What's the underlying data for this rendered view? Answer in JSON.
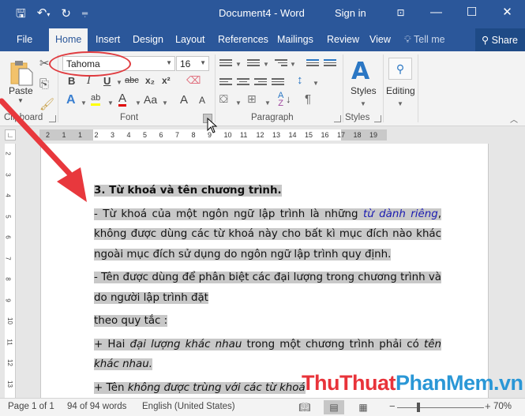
{
  "window": {
    "title": "Document4  -  Word",
    "sign_in": "Sign in",
    "qat_icons": [
      "save-icon",
      "undo-icon",
      "redo-icon",
      "customize-qat-icon"
    ],
    "window_controls": [
      "ribbon-display-options-icon",
      "minimize-icon",
      "maximize-icon",
      "close-icon"
    ]
  },
  "tabs": [
    {
      "label": "File"
    },
    {
      "label": "Home",
      "active": true
    },
    {
      "label": "Insert"
    },
    {
      "label": "Design"
    },
    {
      "label": "Layout"
    },
    {
      "label": "References"
    },
    {
      "label": "Mailings"
    },
    {
      "label": "Review"
    },
    {
      "label": "View"
    },
    {
      "label": "Tell me"
    }
  ],
  "share_label": "Share",
  "ribbon": {
    "clipboard": {
      "label": "Clipboard",
      "paste_label": "Paste"
    },
    "font": {
      "label": "Font",
      "font_name": "Tahoma",
      "font_size": "16",
      "bold": "B",
      "italic": "I",
      "underline": "U",
      "strikethrough": "abc",
      "subscript": "x₂",
      "superscript": "x²",
      "change_case": "Aa",
      "grow": "A",
      "shrink": "A",
      "highlight_color": "#ffff00",
      "font_color": "#e00000"
    },
    "paragraph": {
      "label": "Paragraph"
    },
    "styles": {
      "label": "Styles",
      "button_label": "Styles"
    },
    "editing": {
      "button_label": "Editing"
    }
  },
  "ruler": {
    "labels": [
      "2",
      "1",
      "1",
      "2",
      "3",
      "4",
      "5",
      "6",
      "7",
      "8",
      "9",
      "10",
      "11",
      "12",
      "13",
      "14",
      "15",
      "16",
      "17",
      "18",
      "19"
    ],
    "vertical_labels": [
      "2",
      "3",
      "4",
      "5",
      "6",
      "7",
      "8",
      "9",
      "10",
      "11",
      "12",
      "13"
    ]
  },
  "document": {
    "heading": "3. Từ khoá và tên chương trình.",
    "p1_before": "- Từ khoá của một ngôn ngữ lập trình là những ",
    "p1_keyword": "từ dành riêng",
    "p1_after": ", không được dùng các từ khoá này cho bất kì mục đích nào khác ngoài mục đích sử dụng do ngôn ngữ lập trình quy định.",
    "p2": "- Tên được dùng để phân biệt các đại lượng trong chương trình và do người lập trình đặt",
    "p3": "theo quy tắc :",
    "p4_a": " + Hai ",
    "p4_b": "đại lượng khác nhau",
    "p4_c": " trong một chương trình phải có ",
    "p4_d": "tên khác nhau.",
    "p5_a": " + Tên ",
    "p5_b": "không được trùng với các từ khoá"
  },
  "status": {
    "page": "Page 1 of 1",
    "words": "94 of 94 words",
    "language": "English (United States)",
    "zoom": "70%",
    "zoom_fraction": 0.35
  },
  "watermark": {
    "part1": "ThuThuat",
    "part2": "PhanMem.vn"
  },
  "colors": {
    "accent": "#2b579a",
    "selection": "#c8c8c8",
    "annotation": "#e03b3f"
  }
}
